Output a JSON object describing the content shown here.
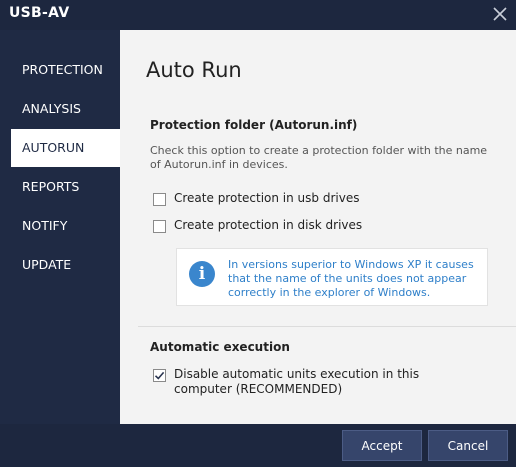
{
  "window": {
    "title": "USB-AV"
  },
  "sidebar": {
    "items": [
      {
        "label": "PROTECTION"
      },
      {
        "label": "ANALYSIS"
      },
      {
        "label": "AUTORUN",
        "active": true
      },
      {
        "label": "REPORTS"
      },
      {
        "label": "NOTIFY"
      },
      {
        "label": "UPDATE"
      }
    ]
  },
  "page": {
    "title": "Auto Run",
    "protection_folder": {
      "heading": "Protection folder (Autorun.inf)",
      "description": "Check this option to create a protection folder with the name of Autorun.inf in devices.",
      "options": [
        {
          "label": "Create protection in usb drives",
          "checked": false
        },
        {
          "label": "Create protection in disk drives",
          "checked": false
        }
      ],
      "info": "In versions superior to Windows XP it causes that the name of the units does not appear correctly in the explorer of Windows."
    },
    "automatic_execution": {
      "heading": "Automatic execution",
      "option": {
        "label": "Disable automatic units execution in this computer (RECOMMENDED)",
        "checked": true
      }
    }
  },
  "footer": {
    "accept_label": "Accept",
    "cancel_label": "Cancel"
  },
  "icons": {
    "close": "close-icon",
    "info": "info-icon",
    "check": "checkmark-icon"
  },
  "colors": {
    "sidebar_bg": "#1f2a44",
    "content_bg": "#f3f3f3",
    "info_text": "#2e7fc9",
    "button_bg": "#36456b"
  }
}
